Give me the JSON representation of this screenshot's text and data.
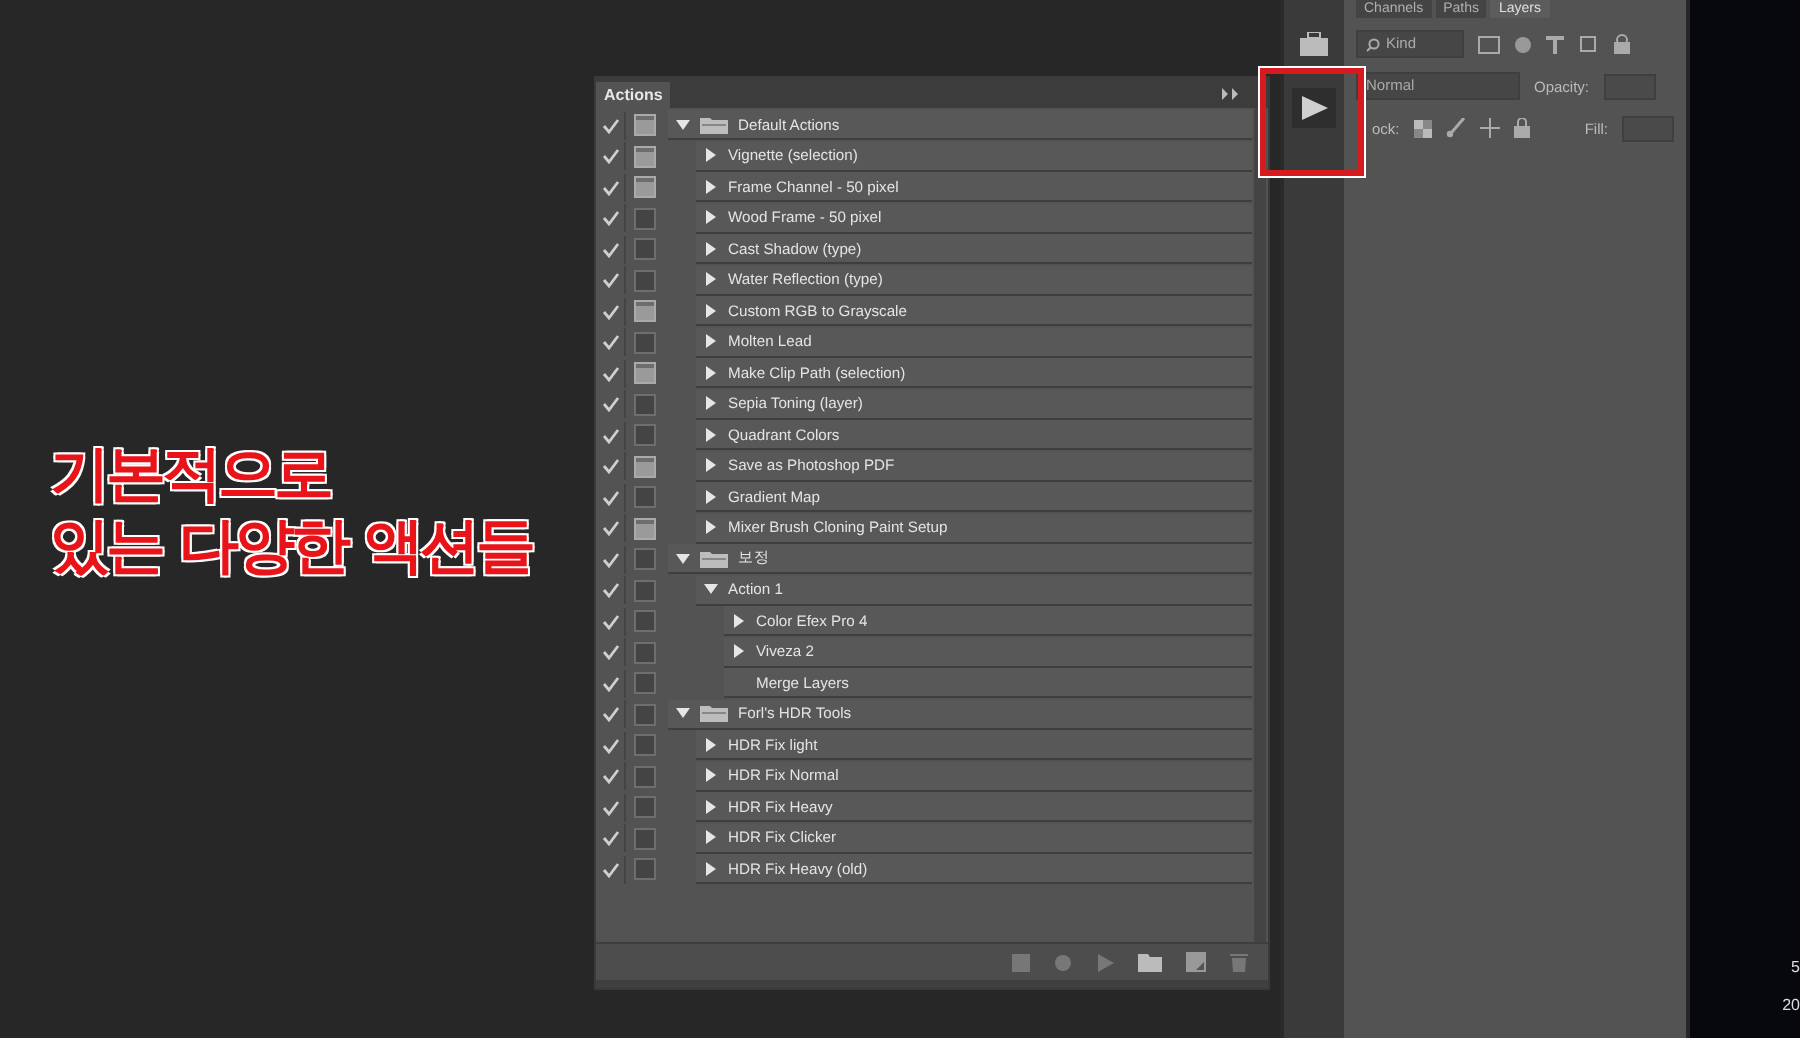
{
  "actions_panel": {
    "title": "Actions",
    "items": [
      {
        "kind": "set",
        "label": "Default Actions",
        "checked": true,
        "dialog": true,
        "expanded": true,
        "children": [
          {
            "kind": "action",
            "label": "Vignette (selection)",
            "checked": true,
            "dialog": true,
            "expanded": false
          },
          {
            "kind": "action",
            "label": "Frame Channel - 50 pixel",
            "checked": true,
            "dialog": true,
            "expanded": false
          },
          {
            "kind": "action",
            "label": "Wood Frame - 50 pixel",
            "checked": true,
            "dialog": false,
            "expanded": false
          },
          {
            "kind": "action",
            "label": "Cast Shadow (type)",
            "checked": true,
            "dialog": false,
            "expanded": false
          },
          {
            "kind": "action",
            "label": "Water Reflection (type)",
            "checked": true,
            "dialog": false,
            "expanded": false
          },
          {
            "kind": "action",
            "label": "Custom RGB to Grayscale",
            "checked": true,
            "dialog": true,
            "expanded": false
          },
          {
            "kind": "action",
            "label": "Molten Lead",
            "checked": true,
            "dialog": false,
            "expanded": false
          },
          {
            "kind": "action",
            "label": "Make Clip Path (selection)",
            "checked": true,
            "dialog": true,
            "expanded": false
          },
          {
            "kind": "action",
            "label": "Sepia Toning (layer)",
            "checked": true,
            "dialog": false,
            "expanded": false
          },
          {
            "kind": "action",
            "label": "Quadrant Colors",
            "checked": true,
            "dialog": false,
            "expanded": false
          },
          {
            "kind": "action",
            "label": "Save as Photoshop PDF",
            "checked": true,
            "dialog": true,
            "expanded": false
          },
          {
            "kind": "action",
            "label": "Gradient Map",
            "checked": true,
            "dialog": false,
            "expanded": false
          },
          {
            "kind": "action",
            "label": "Mixer Brush Cloning Paint Setup",
            "checked": true,
            "dialog": true,
            "expanded": false
          }
        ]
      },
      {
        "kind": "set",
        "label": "보정",
        "checked": true,
        "dialog": false,
        "expanded": true,
        "children": [
          {
            "kind": "action",
            "label": "Action 1",
            "checked": true,
            "dialog": false,
            "expanded": true,
            "children": [
              {
                "kind": "command",
                "label": "Color Efex Pro 4",
                "checked": true,
                "dialog": false,
                "expanded": false,
                "has_details": true
              },
              {
                "kind": "command",
                "label": "Viveza 2",
                "checked": true,
                "dialog": false,
                "expanded": false,
                "has_details": true
              },
              {
                "kind": "command",
                "label": "Merge Layers",
                "checked": true,
                "dialog": false,
                "has_details": false
              }
            ]
          }
        ]
      },
      {
        "kind": "set",
        "label": "Forl's HDR Tools",
        "checked": true,
        "dialog": false,
        "expanded": true,
        "children": [
          {
            "kind": "action",
            "label": "HDR Fix light",
            "checked": true,
            "dialog": false,
            "expanded": false
          },
          {
            "kind": "action",
            "label": "HDR Fix Normal",
            "checked": true,
            "dialog": false,
            "expanded": false
          },
          {
            "kind": "action",
            "label": "HDR Fix Heavy",
            "checked": true,
            "dialog": false,
            "expanded": false
          },
          {
            "kind": "action",
            "label": "HDR Fix Clicker",
            "checked": true,
            "dialog": false,
            "expanded": false
          },
          {
            "kind": "action",
            "label": "HDR Fix Heavy (old)",
            "checked": true,
            "dialog": false,
            "expanded": false
          }
        ]
      }
    ]
  },
  "dock": {
    "play_selected": true
  },
  "layers_panel": {
    "tabs": [
      {
        "label": "Channels",
        "selected": false
      },
      {
        "label": "Paths",
        "selected": false
      },
      {
        "label": "Layers",
        "selected": true
      }
    ],
    "filter": "Kind",
    "blend_mode": "Normal",
    "opacity_label": "Opacity:",
    "lock_label": "ock:",
    "fill_label": "Fill:"
  },
  "canvas_texts": [
    "5",
    "20"
  ],
  "annotation": {
    "lines": [
      "기본적으로",
      "있는 다양한 액션들"
    ]
  }
}
